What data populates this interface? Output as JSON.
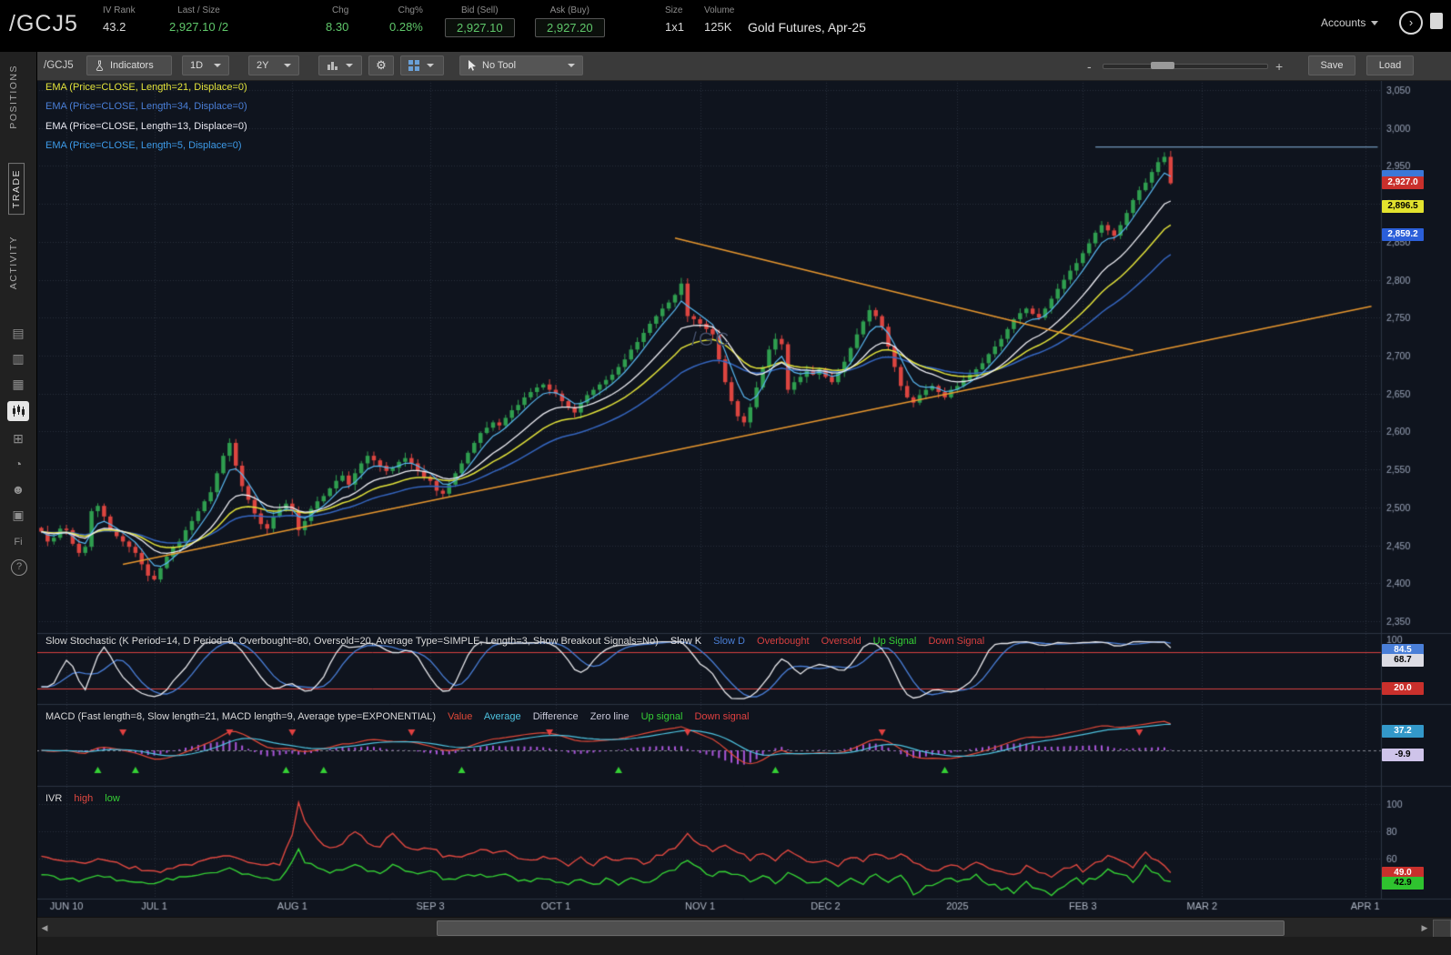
{
  "header": {
    "symbol": "/GCJ5",
    "fields": [
      {
        "label": "IV Rank",
        "value": "43.2"
      },
      {
        "label": "Last / Size",
        "value": "2,927.10 /2"
      },
      {
        "label": "Chg",
        "value": "8.30"
      },
      {
        "label": "Chg%",
        "value": "0.28%"
      },
      {
        "label": "Bid (Sell)",
        "value": "2,927.10"
      },
      {
        "label": "Ask (Buy)",
        "value": "2,927.20"
      },
      {
        "label": "Size",
        "value": "1x1"
      },
      {
        "label": "Volume",
        "value": "125K"
      }
    ],
    "description": "Gold Futures, Apr-25",
    "accounts_label": "Accounts"
  },
  "sidebar": {
    "tabs": [
      {
        "label": "POSITIONS"
      },
      {
        "label": "TRADE"
      },
      {
        "label": "ACTIVITY"
      }
    ],
    "icons": [
      {
        "name": "report-icon",
        "glyph": "▤"
      },
      {
        "name": "watchlist-icon",
        "glyph": "▥"
      },
      {
        "name": "calendar-icon",
        "glyph": "▦"
      },
      {
        "name": "charts-icon",
        "glyph": ""
      },
      {
        "name": "widgets-icon",
        "glyph": "⊞"
      },
      {
        "name": "history-icon",
        "glyph": "◔"
      },
      {
        "name": "clients-icon",
        "glyph": "☻"
      },
      {
        "name": "capture-icon",
        "glyph": "▣"
      },
      {
        "name": "forex-icon",
        "glyph": "Fi"
      },
      {
        "name": "help-icon",
        "glyph": "?"
      }
    ]
  },
  "toolbar": {
    "symbol_label": "/GCJ5",
    "indicators_label": "Indicators",
    "timeframe": "1D",
    "range": "2Y",
    "tool_label": "No Tool",
    "zoom_minus": "-",
    "zoom_plus": "+",
    "save_label": "Save",
    "load_label": "Load"
  },
  "chart_data": {
    "type": "candlestick",
    "symbol": "/GCJ5",
    "title": "Gold Futures, Apr-25",
    "watermark": "/GC",
    "price_axis": {
      "min": 2350,
      "max": 3050,
      "tick": 50
    },
    "total_slots": 213,
    "x_ticks": [
      {
        "label": "JUN 10",
        "i": 4
      },
      {
        "label": "JUL 1",
        "i": 18
      },
      {
        "label": "AUG 1",
        "i": 40
      },
      {
        "label": "SEP 3",
        "i": 62
      },
      {
        "label": "OCT 1",
        "i": 82
      },
      {
        "label": "NOV 1",
        "i": 105
      },
      {
        "label": "DEC 2",
        "i": 125
      },
      {
        "label": "2025",
        "i": 146
      },
      {
        "label": "FEB 3",
        "i": 166
      },
      {
        "label": "MAR 2",
        "i": 185
      },
      {
        "label": "APR 1",
        "i": 211
      }
    ],
    "closes": [
      2468,
      2455,
      2460,
      2472,
      2470,
      2452,
      2440,
      2448,
      2495,
      2502,
      2488,
      2470,
      2462,
      2455,
      2448,
      2440,
      2425,
      2410,
      2405,
      2420,
      2435,
      2448,
      2455,
      2470,
      2482,
      2495,
      2508,
      2520,
      2545,
      2568,
      2585,
      2555,
      2528,
      2510,
      2492,
      2478,
      2472,
      2488,
      2498,
      2505,
      2495,
      2470,
      2482,
      2498,
      2508,
      2515,
      2525,
      2535,
      2542,
      2530,
      2545,
      2558,
      2568,
      2562,
      2555,
      2548,
      2552,
      2560,
      2565,
      2558,
      2548,
      2540,
      2535,
      2522,
      2518,
      2530,
      2545,
      2558,
      2572,
      2585,
      2598,
      2605,
      2612,
      2608,
      2618,
      2628,
      2635,
      2645,
      2652,
      2658,
      2662,
      2655,
      2650,
      2640,
      2632,
      2625,
      2638,
      2648,
      2655,
      2662,
      2668,
      2675,
      2685,
      2695,
      2708,
      2718,
      2730,
      2742,
      2752,
      2762,
      2770,
      2780,
      2795,
      2752,
      2748,
      2742,
      2735,
      2728,
      2695,
      2665,
      2640,
      2620,
      2612,
      2632,
      2658,
      2685,
      2708,
      2722,
      2715,
      2655,
      2665,
      2672,
      2680,
      2675,
      2682,
      2672,
      2665,
      2678,
      2692,
      2710,
      2728,
      2745,
      2760,
      2752,
      2738,
      2712,
      2685,
      2660,
      2645,
      2638,
      2648,
      2655,
      2660,
      2652,
      2645,
      2655,
      2660,
      2668,
      2675,
      2682,
      2690,
      2702,
      2712,
      2722,
      2735,
      2748,
      2756,
      2762,
      2755,
      2750,
      2762,
      2775,
      2788,
      2800,
      2812,
      2822,
      2835,
      2848,
      2862,
      2872,
      2865,
      2858,
      2872,
      2888,
      2905,
      2918,
      2928,
      2942,
      2955,
      2962,
      2927.1
    ],
    "emas": [
      {
        "period": 34,
        "color": "#3566c0",
        "width": 1.5
      },
      {
        "period": 21,
        "color": "#e3e33a",
        "width": 1.5
      },
      {
        "period": 5,
        "color": "#59b7f0",
        "width": 1.2
      },
      {
        "period": 13,
        "color": "#eeeef4",
        "width": 1.3
      }
    ],
    "drawings": [
      {
        "type": "trendline",
        "i1": 13,
        "p1": 2425,
        "i2": 212,
        "p2": 2765,
        "color": "#e8972e",
        "width": 1.6
      },
      {
        "type": "trendline",
        "i1": 101,
        "p1": 2855,
        "i2": 174,
        "p2": 2707,
        "color": "#e8972e",
        "width": 1.6
      },
      {
        "type": "horizontal",
        "i1": 168,
        "p1": 2975,
        "i2": 213,
        "p2": 2975,
        "color": "#6f95b8",
        "width": 1.2
      }
    ],
    "colors": {
      "background": "#0f141e",
      "grid": "rgba(140,155,185,0.20)",
      "axis_text": "#9aa4b8",
      "up": "#2f9e4f",
      "down": "#dc4540"
    },
    "studies": {
      "ema_labels": [
        {
          "text": "EMA (Price=CLOSE, Length=21, Displace=0)",
          "color": "#e3e33a"
        },
        {
          "text": "EMA (Price=CLOSE, Length=34, Displace=0)",
          "color": "#4a7fd8"
        },
        {
          "text": "EMA (Price=CLOSE, Length=13, Displace=0)",
          "color": "#e8e8f0"
        },
        {
          "text": "EMA (Price=CLOSE, Length=5, Displace=0)",
          "color": "#3d9be9"
        }
      ],
      "stochastic": {
        "label": "Slow Stochastic (K Period=14, D Period=9, Overbought=80, Oversold=20, Average Type=SIMPLE, Length=3, Show Breakout Signals=No)",
        "legend": [
          {
            "text": "Slow K",
            "color": "#e8e8ec"
          },
          {
            "text": "Slow D",
            "color": "#4a7fd8"
          },
          {
            "text": "Overbought",
            "color": "#d84040"
          },
          {
            "text": "Oversold",
            "color": "#d84040"
          },
          {
            "text": "Up Signal",
            "color": "#35d035"
          },
          {
            "text": "Down Signal",
            "color": "#d84040"
          }
        ],
        "overbought": 80,
        "oversold": 20,
        "axis_top": "100"
      },
      "macd": {
        "label": "MACD (Fast length=8, Slow length=21, MACD length=9, Average type=EXPONENTIAL)",
        "legend": [
          {
            "text": "Value",
            "color": "#e04838"
          },
          {
            "text": "Average",
            "color": "#4ec3e0"
          },
          {
            "text": "Difference",
            "color": "#c8c8d8"
          },
          {
            "text": "Zero line",
            "color": "#c8c8d8"
          },
          {
            "text": "Up signal",
            "color": "#35d035"
          },
          {
            "text": "Down signal",
            "color": "#e04040"
          }
        ],
        "fast": 8,
        "slow": 21,
        "signal": 9,
        "hist_color": "#a855d8",
        "zero_color": "rgba(230,230,240,0.55)",
        "up_signals": [
          9,
          15,
          39,
          45,
          67,
          92,
          117,
          144
        ],
        "down_signals": [
          13,
          30,
          40,
          59,
          81,
          103,
          134,
          175
        ]
      },
      "ivr": {
        "label": "IVR",
        "legend": [
          {
            "text": "high",
            "color": "#e04840"
          },
          {
            "text": "low",
            "color": "#35d035"
          }
        ],
        "axis": [
          100,
          80,
          60
        ],
        "high_anchors": [
          [
            0,
            62
          ],
          [
            6,
            56
          ],
          [
            10,
            60
          ],
          [
            14,
            54
          ],
          [
            18,
            50
          ],
          [
            22,
            55
          ],
          [
            26,
            58
          ],
          [
            30,
            63
          ],
          [
            34,
            56
          ],
          [
            38,
            55
          ],
          [
            40,
            78
          ],
          [
            41,
            100
          ],
          [
            42,
            86
          ],
          [
            44,
            74
          ],
          [
            46,
            68
          ],
          [
            48,
            72
          ],
          [
            50,
            80
          ],
          [
            52,
            72
          ],
          [
            54,
            68
          ],
          [
            56,
            80
          ],
          [
            58,
            70
          ],
          [
            60,
            66
          ],
          [
            62,
            68
          ],
          [
            64,
            62
          ],
          [
            66,
            60
          ],
          [
            68,
            64
          ],
          [
            70,
            68
          ],
          [
            72,
            63
          ],
          [
            74,
            66
          ],
          [
            76,
            61
          ],
          [
            78,
            58
          ],
          [
            80,
            62
          ],
          [
            82,
            60
          ],
          [
            84,
            56
          ],
          [
            86,
            60
          ],
          [
            88,
            55
          ],
          [
            90,
            62
          ],
          [
            92,
            58
          ],
          [
            94,
            60
          ],
          [
            96,
            56
          ],
          [
            98,
            62
          ],
          [
            100,
            66
          ],
          [
            102,
            72
          ],
          [
            103,
            78
          ],
          [
            105,
            70
          ],
          [
            107,
            66
          ],
          [
            109,
            70
          ],
          [
            111,
            64
          ],
          [
            113,
            60
          ],
          [
            115,
            64
          ],
          [
            117,
            58
          ],
          [
            119,
            66
          ],
          [
            121,
            60
          ],
          [
            123,
            56
          ],
          [
            125,
            60
          ],
          [
            127,
            55
          ],
          [
            129,
            62
          ],
          [
            131,
            58
          ],
          [
            133,
            64
          ],
          [
            135,
            60
          ],
          [
            137,
            64
          ],
          [
            139,
            58
          ],
          [
            141,
            54
          ],
          [
            143,
            50
          ],
          [
            145,
            55
          ],
          [
            147,
            52
          ],
          [
            149,
            58
          ],
          [
            151,
            54
          ],
          [
            153,
            50
          ],
          [
            155,
            48
          ],
          [
            157,
            54
          ],
          [
            159,
            50
          ],
          [
            161,
            46
          ],
          [
            163,
            52
          ],
          [
            165,
            56
          ],
          [
            166,
            50
          ],
          [
            168,
            56
          ],
          [
            170,
            62
          ],
          [
            172,
            58
          ],
          [
            174,
            54
          ],
          [
            176,
            64
          ],
          [
            178,
            58
          ],
          [
            180,
            49
          ]
        ],
        "low_anchors": [
          [
            0,
            48
          ],
          [
            6,
            44
          ],
          [
            10,
            47
          ],
          [
            14,
            42
          ],
          [
            18,
            43
          ],
          [
            22,
            46
          ],
          [
            26,
            48
          ],
          [
            30,
            52
          ],
          [
            34,
            46
          ],
          [
            38,
            45
          ],
          [
            40,
            58
          ],
          [
            41,
            66
          ],
          [
            42,
            58
          ],
          [
            44,
            52
          ],
          [
            46,
            49
          ],
          [
            48,
            52
          ],
          [
            50,
            57
          ],
          [
            52,
            52
          ],
          [
            54,
            49
          ],
          [
            56,
            56
          ],
          [
            58,
            50
          ],
          [
            60,
            48
          ],
          [
            62,
            50
          ],
          [
            64,
            46
          ],
          [
            66,
            44
          ],
          [
            68,
            47
          ],
          [
            70,
            50
          ],
          [
            72,
            46
          ],
          [
            74,
            48
          ],
          [
            76,
            44
          ],
          [
            78,
            42
          ],
          [
            80,
            46
          ],
          [
            82,
            44
          ],
          [
            84,
            41
          ],
          [
            86,
            45
          ],
          [
            88,
            40
          ],
          [
            90,
            46
          ],
          [
            92,
            42
          ],
          [
            94,
            45
          ],
          [
            96,
            41
          ],
          [
            98,
            46
          ],
          [
            100,
            50
          ],
          [
            102,
            55
          ],
          [
            103,
            58
          ],
          [
            105,
            52
          ],
          [
            107,
            48
          ],
          [
            109,
            52
          ],
          [
            111,
            47
          ],
          [
            113,
            44
          ],
          [
            115,
            48
          ],
          [
            117,
            42
          ],
          [
            119,
            50
          ],
          [
            121,
            44
          ],
          [
            123,
            41
          ],
          [
            125,
            45
          ],
          [
            127,
            40
          ],
          [
            129,
            46
          ],
          [
            131,
            42
          ],
          [
            133,
            48
          ],
          [
            135,
            44
          ],
          [
            137,
            48
          ],
          [
            139,
            34
          ],
          [
            141,
            40
          ],
          [
            143,
            42
          ],
          [
            145,
            46
          ],
          [
            147,
            43
          ],
          [
            149,
            47
          ],
          [
            151,
            42
          ],
          [
            153,
            38
          ],
          [
            155,
            36
          ],
          [
            157,
            42
          ],
          [
            159,
            38
          ],
          [
            161,
            34
          ],
          [
            163,
            40
          ],
          [
            165,
            45
          ],
          [
            166,
            42
          ],
          [
            168,
            46
          ],
          [
            170,
            52
          ],
          [
            172,
            48
          ],
          [
            174,
            44
          ],
          [
            176,
            54
          ],
          [
            178,
            48
          ],
          [
            180,
            42.9
          ]
        ]
      }
    },
    "badges": {
      "price_last": "2,927.0",
      "price_ema21": "2,896.5",
      "price_ema34": "2,859.2",
      "stoch_d": "84.5",
      "stoch_k": "68.7",
      "stoch_oversold": "20.0",
      "macd_avg": "37.2",
      "macd_diff": "-9.9",
      "ivr_high": "49.0",
      "ivr_low": "42.9"
    }
  }
}
